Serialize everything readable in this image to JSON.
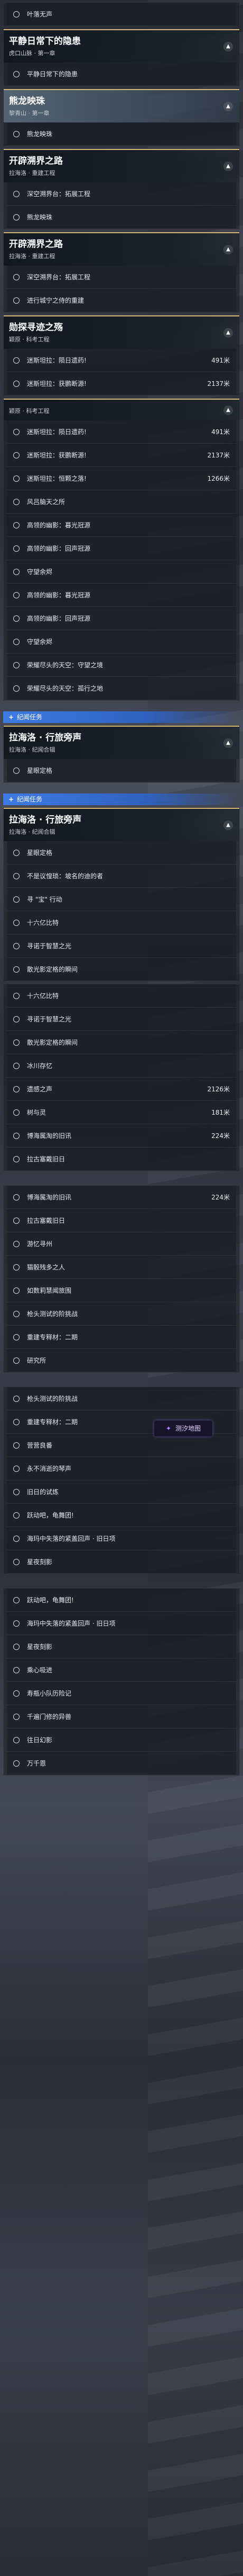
{
  "floating_badge": {
    "label": "测汐地图",
    "icon": "sparkle-icon"
  },
  "blocks": [
    {
      "type": "items",
      "items": [
        {
          "label": "叶落无声"
        }
      ]
    },
    {
      "type": "panel",
      "title": "平静日常下的隐患",
      "subtitle": "虎口山脉 · 第一章",
      "items": [
        {
          "label": "平静日常下的隐患"
        }
      ]
    },
    {
      "type": "panel",
      "title": "熊龙映珠",
      "subtitle": "黎青山 · 第一章",
      "light": true,
      "items": [
        {
          "label": "熊龙映珠"
        }
      ]
    },
    {
      "type": "panel",
      "title": "开辟溯界之路",
      "subtitle": "拉海洛 · 重建工程",
      "items": [
        {
          "label": "深空溯界台：拓展工程"
        },
        {
          "label": "熊龙映珠"
        }
      ]
    },
    {
      "type": "panel",
      "title": "开辟溯界之路",
      "subtitle": "拉海洛 · 重建工程",
      "items": [
        {
          "label": "深空溯界台：拓展工程"
        },
        {
          "label": "进行城宁之侍的重建"
        }
      ]
    },
    {
      "type": "panel",
      "title": "勋探寻迹之殇",
      "subtitle": "颖原 · 科考工程",
      "items": [
        {
          "label": "迷斯坦拉：陨日遗药!",
          "distance": "491米"
        },
        {
          "label": "迷斯坦拉：获鹏断源!",
          "distance": "2137米"
        }
      ]
    },
    {
      "type": "panel",
      "title": "",
      "subtitle": "颖原 · 科考工程",
      "items": [
        {
          "label": "迷斯坦拉：陨日遗药!",
          "distance": "491米"
        },
        {
          "label": "迷斯坦拉：获鹏断源!",
          "distance": "2137米"
        },
        {
          "label": "迷斯坦拉：恒颗之落!",
          "distance": "1266米"
        },
        {
          "label": "风吕脑天之所"
        },
        {
          "label": "高领的幽影：暮光冠源"
        },
        {
          "label": "高领的幽影：回声冠源"
        },
        {
          "label": "守望余烬"
        },
        {
          "label": "高领的幽影：暮光冠源"
        },
        {
          "label": "高领的幽影：回声冠源"
        },
        {
          "label": "守望余烬"
        },
        {
          "label": "荣耀尽头的天空：守望之境"
        },
        {
          "label": "荣耀尽头的天空：孤行之地"
        }
      ]
    },
    {
      "type": "section_tag",
      "label": "纪闻任务"
    },
    {
      "type": "panel",
      "title": "拉海洛 · 行旅旁声",
      "subtitle": "拉海洛 · 纪闻合辑",
      "items": [
        {
          "label": "星眼定格"
        }
      ]
    },
    {
      "type": "section_tag",
      "label": "纪闻任务"
    },
    {
      "type": "panel",
      "title": "拉海洛 · 行旅旁声",
      "subtitle": "拉海洛 · 纪闻合辑",
      "items": [
        {
          "label": "星眼定格"
        },
        {
          "label": "不是议惶琐：坡名的迪的者"
        },
        {
          "label": "寻 \"宝\" 行动"
        },
        {
          "label": "十六亿比特"
        },
        {
          "label": "寻诺于智慧之光"
        },
        {
          "label": "散光影定格的瞬间"
        }
      ]
    },
    {
      "type": "items",
      "items": [
        {
          "label": "十六亿比特"
        },
        {
          "label": "寻诺于智慧之光"
        },
        {
          "label": "散光影定格的瞬间"
        },
        {
          "label": "冰川存忆"
        },
        {
          "label": "遗感之声",
          "distance": "2126米"
        },
        {
          "label": "树与灵",
          "distance": "181米"
        },
        {
          "label": "博海属淘的旧讯",
          "distance": "224米"
        },
        {
          "label": "拉古塞戴旧日"
        }
      ]
    },
    {
      "type": "items",
      "gap": true,
      "items": [
        {
          "label": "博海属淘的旧讯",
          "distance": "224米"
        },
        {
          "label": "拉古塞戴旧日"
        },
        {
          "label": "游忆寻州"
        },
        {
          "label": "猫骰残多之人"
        },
        {
          "label": "如数莉慧闻旅围"
        },
        {
          "label": "枪头测试的阶挑战"
        },
        {
          "label": "重建专释材：二期"
        },
        {
          "label": "研究所"
        }
      ]
    },
    {
      "type": "items",
      "gap": true,
      "items": [
        {
          "label": "枪头测试的阶挑战"
        },
        {
          "label": "重建专释材：二期"
        },
        {
          "label": "营营良番"
        },
        {
          "label": "永不消逝的琴声"
        },
        {
          "label": "旧日的试炼"
        },
        {
          "label": "跃动吧，龟舞团!"
        },
        {
          "label": "海玛中失落的紧盖回声 · 旧日项"
        },
        {
          "label": "星夜刻影"
        }
      ]
    },
    {
      "type": "items",
      "gap": true,
      "items": [
        {
          "label": "跃动吧，龟舞团!"
        },
        {
          "label": "海玛中失落的紧盖回声 · 旧日项"
        },
        {
          "label": "星夜刻影"
        },
        {
          "label": "乘心吸进"
        },
        {
          "label": "寿瓶小队历险记"
        },
        {
          "label": "千遍门修的异兽"
        },
        {
          "label": "往日幻影"
        },
        {
          "label": "万千恩"
        }
      ]
    }
  ]
}
